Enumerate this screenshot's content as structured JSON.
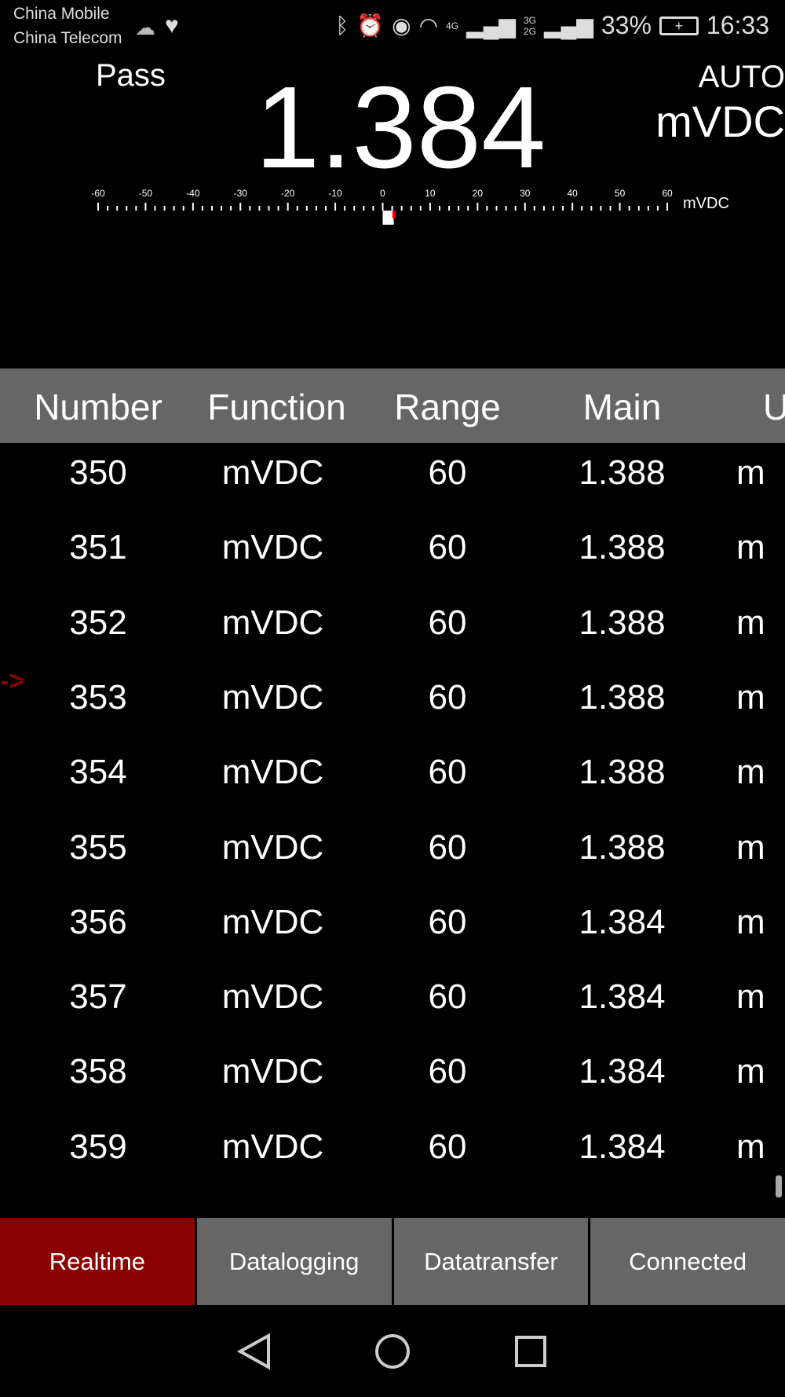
{
  "status_bar": {
    "carrier1": "China Mobile",
    "carrier2": "China Telecom",
    "battery": "33%",
    "time": "16:33",
    "net1": "4G",
    "net2": "3G 2G",
    "icons": [
      "weather-icon",
      "health-icon",
      "bluetooth-icon",
      "alarm-icon",
      "eye-comfort-icon",
      "wifi-icon",
      "signal-icon",
      "battery-icon"
    ]
  },
  "meter": {
    "status": "Pass",
    "value": "1.384",
    "range_mode": "AUTO",
    "unit": "mVDC",
    "scale": {
      "min": -60,
      "max": 60,
      "labels": [
        "-60",
        "-50",
        "-40",
        "-30",
        "-20",
        "-10",
        "0",
        "10",
        "20",
        "30",
        "40",
        "50",
        "60"
      ],
      "unit": "mVDC",
      "pointer_value": 1.384
    }
  },
  "table": {
    "headers": [
      "Number",
      "Function",
      "Range",
      "Main",
      "U"
    ],
    "rows": [
      [
        "350",
        "mVDC",
        "60",
        "1.388",
        "m"
      ],
      [
        "351",
        "mVDC",
        "60",
        "1.388",
        "m"
      ],
      [
        "352",
        "mVDC",
        "60",
        "1.388",
        "m"
      ],
      [
        "353",
        "mVDC",
        "60",
        "1.388",
        "m"
      ],
      [
        "354",
        "mVDC",
        "60",
        "1.388",
        "m"
      ],
      [
        "355",
        "mVDC",
        "60",
        "1.388",
        "m"
      ],
      [
        "356",
        "mVDC",
        "60",
        "1.384",
        "m"
      ],
      [
        "357",
        "mVDC",
        "60",
        "1.384",
        "m"
      ],
      [
        "358",
        "mVDC",
        "60",
        "1.384",
        "m"
      ],
      [
        "359",
        "mVDC",
        "60",
        "1.384",
        "m"
      ]
    ],
    "cursor": "->"
  },
  "tabs": [
    {
      "label": "Realtime",
      "active": true
    },
    {
      "label": "Datalogging"
    },
    {
      "label": "Datatransfer"
    },
    {
      "label": "Connected"
    }
  ],
  "colors": {
    "accent": "#8b0000",
    "header_bg": "#666666",
    "pointer": "#ff0000"
  }
}
